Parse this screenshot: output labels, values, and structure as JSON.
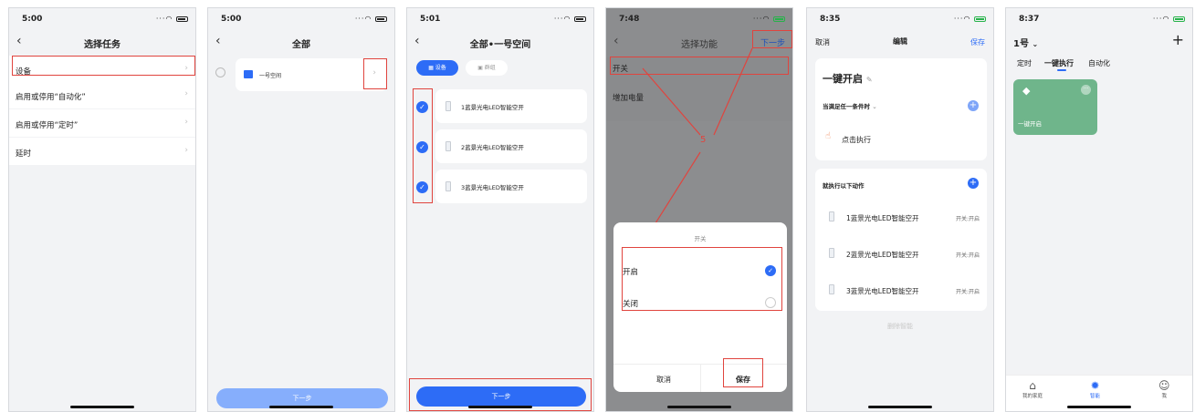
{
  "screens": {
    "s1": {
      "time": "5:00",
      "title": "选择任务",
      "rows": [
        "设备",
        "启用或停用“自动化”",
        "启用或停用“定时”",
        "延时"
      ]
    },
    "s2": {
      "time": "5:00",
      "title": "全部",
      "space_item": "一号空间",
      "next_button": "下一步"
    },
    "s3": {
      "time": "5:01",
      "title": "全部•一号空间",
      "tab_devices": "设备",
      "tab_groups": "群组",
      "devices": [
        "1蓝景光电LED智能空开",
        "2蓝景光电LED智能空开",
        "3蓝景光电LED智能空开"
      ],
      "next_button": "下一步"
    },
    "s4": {
      "time": "7:48",
      "title": "选择功能",
      "next_link": "下一步",
      "functions": [
        "开关",
        "增加电量"
      ],
      "annotation": "5",
      "sheet": {
        "title": "开关",
        "options": [
          "开启",
          "关闭"
        ],
        "cancel": "取消",
        "save": "保存"
      }
    },
    "s5": {
      "time": "8:35",
      "cancel": "取消",
      "title": "编辑",
      "save": "保存",
      "scene_name": "一键开启",
      "condition_header": "当满足任一条件时",
      "condition_item": "点击执行",
      "action_header": "就执行以下动作",
      "actions": [
        {
          "device": "1蓝景光电LED智能空开",
          "state": "开关:开启"
        },
        {
          "device": "2蓝景光电LED智能空开",
          "state": "开关:开启"
        },
        {
          "device": "3蓝景光电LED智能空开",
          "state": "开关:开启"
        }
      ],
      "delete": "删除智能"
    },
    "s6": {
      "time": "8:37",
      "home": "1号",
      "tabs": [
        "定时",
        "一键执行",
        "自动化"
      ],
      "scene_card": "一键开启",
      "bottom_tabs": [
        "我的家庭",
        "智能",
        "我"
      ]
    }
  },
  "colors": {
    "primary": "#2d6cf6",
    "highlight": "#e0443e",
    "scene_card": "#6fb58b"
  },
  "icons": [
    "back-icon",
    "chevron-right-icon",
    "check-icon",
    "plus-icon",
    "edit-icon",
    "tag-icon",
    "more-icon",
    "home-icon",
    "smart-icon",
    "profile-icon",
    "touch-icon",
    "device-icon"
  ]
}
